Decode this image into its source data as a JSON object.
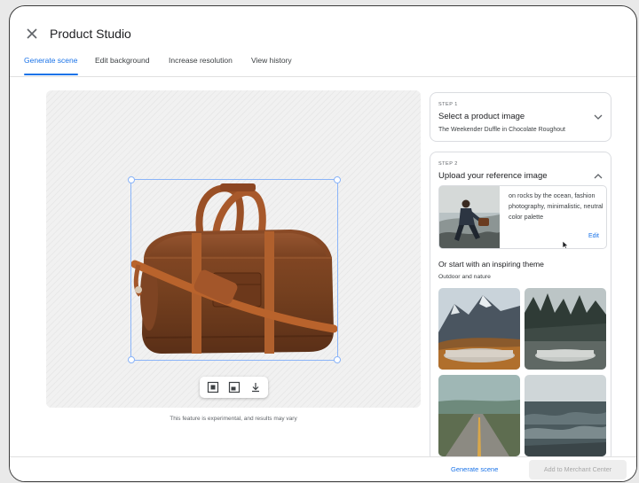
{
  "app": {
    "title": "Product Studio"
  },
  "tabs": [
    {
      "label": "Generate scene",
      "active": true
    },
    {
      "label": "Edit background",
      "active": false
    },
    {
      "label": "Increase resolution",
      "active": false
    },
    {
      "label": "View history",
      "active": false
    }
  ],
  "canvas": {
    "disclaimer": "This feature is experimental, and results may vary",
    "toolbar": [
      "fit-icon",
      "crop-icon",
      "download-icon"
    ]
  },
  "step1": {
    "label": "STEP 1",
    "title": "Select a product image",
    "subtitle": "The Weekender Duffle in Chocolate Roughout",
    "expanded": false
  },
  "step2": {
    "label": "STEP 2",
    "title": "Upload your reference image",
    "expanded": true,
    "reference": {
      "prompt": "on rocks by the ocean, fashion photography, minimalistic, neutral color palette",
      "edit_label": "Edit"
    },
    "theme_heading": "Or start with an inspiring theme",
    "theme_category": "Outdoor and nature",
    "themes": [
      "mountain-rock",
      "misty-forest-rock",
      "desert-road",
      "ocean-waves"
    ]
  },
  "footer": {
    "generate_label": "Generate scene",
    "add_label": "Add to Merchant Center"
  },
  "colors": {
    "accent": "#1a73e8",
    "leather": "#7a4022",
    "selection": "#8ab4f8"
  }
}
